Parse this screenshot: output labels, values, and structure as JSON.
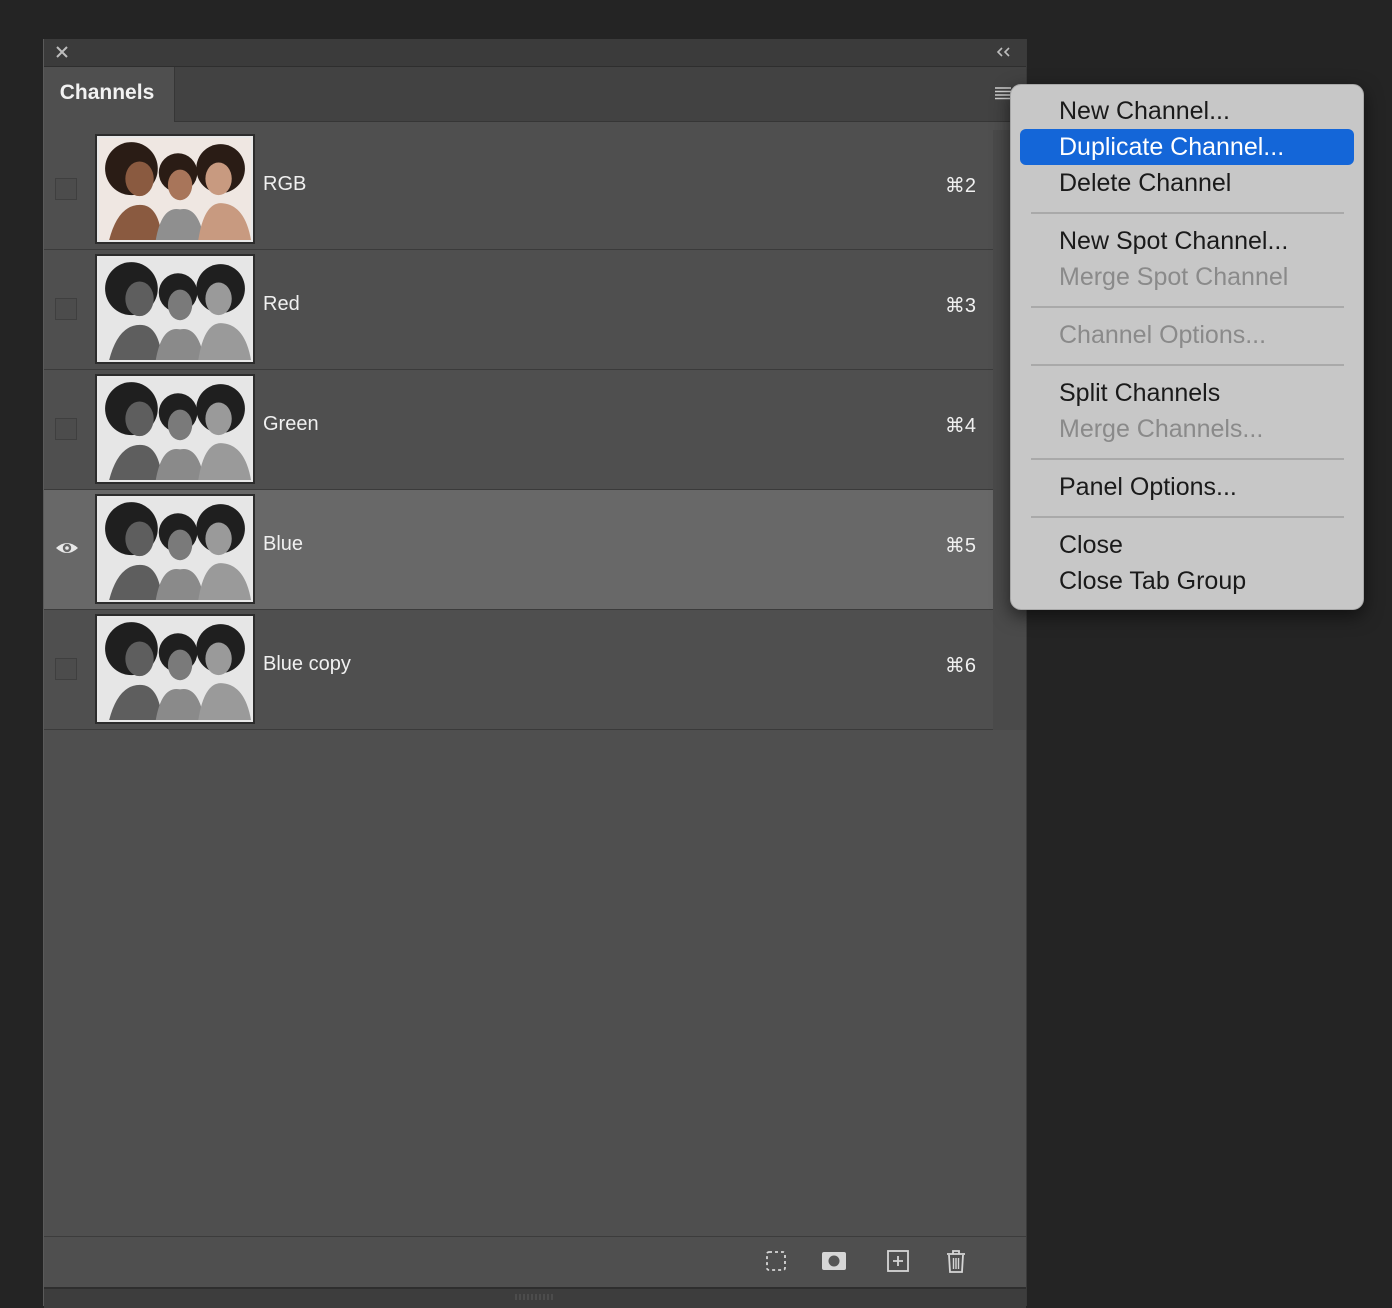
{
  "panel": {
    "tab_label": "Channels",
    "channels": [
      {
        "name": "RGB",
        "shortcut": "⌘2",
        "visible": false,
        "selected": false,
        "color": true
      },
      {
        "name": "Red",
        "shortcut": "⌘3",
        "visible": false,
        "selected": false,
        "color": false
      },
      {
        "name": "Green",
        "shortcut": "⌘4",
        "visible": false,
        "selected": false,
        "color": false
      },
      {
        "name": "Blue",
        "shortcut": "⌘5",
        "visible": true,
        "selected": true,
        "color": false
      },
      {
        "name": "Blue copy",
        "shortcut": "⌘6",
        "visible": false,
        "selected": false,
        "color": false
      }
    ],
    "footer_buttons": [
      "load-selection-icon",
      "save-selection-icon",
      "new-channel-icon",
      "delete-channel-icon"
    ]
  },
  "menu": {
    "items": [
      {
        "label": "New Channel...",
        "enabled": true,
        "highlighted": false
      },
      {
        "label": "Duplicate Channel...",
        "enabled": true,
        "highlighted": true
      },
      {
        "label": "Delete Channel",
        "enabled": true,
        "highlighted": false
      },
      {
        "label": "New Spot Channel...",
        "enabled": true,
        "highlighted": false
      },
      {
        "label": "Merge Spot Channel",
        "enabled": false,
        "highlighted": false
      },
      {
        "label": "Channel Options...",
        "enabled": false,
        "highlighted": false
      },
      {
        "label": "Split Channels",
        "enabled": true,
        "highlighted": false
      },
      {
        "label": "Merge Channels...",
        "enabled": false,
        "highlighted": false
      },
      {
        "label": "Panel Options...",
        "enabled": true,
        "highlighted": false
      },
      {
        "label": "Close",
        "enabled": true,
        "highlighted": false
      },
      {
        "label": "Close Tab Group",
        "enabled": true,
        "highlighted": false
      }
    ]
  },
  "colors": {
    "highlight": "#1466d8",
    "panel_bg": "#4f4f4f",
    "selected_row": "#686868"
  }
}
